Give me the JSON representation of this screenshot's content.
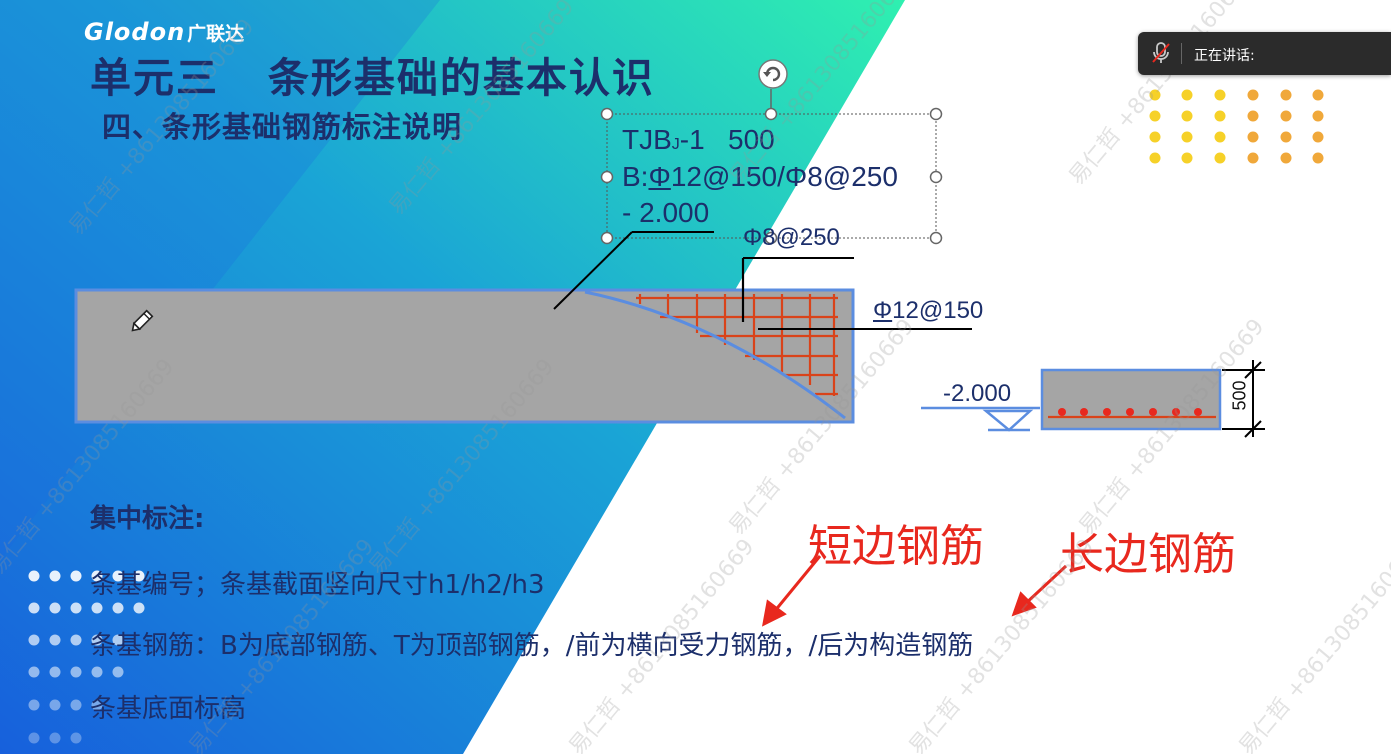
{
  "slide": {
    "logo_latin": "Glodon",
    "logo_cn": "广联达",
    "title": "单元三   条形基础的基本认识",
    "subtitle": "四、条形基础钢筋标注说明",
    "annotation": {
      "line1_main": "TJB",
      "line1_sub": "J",
      "line1_rest": "-1   500",
      "line2_prefix": "B:",
      "line2_phi": "Φ",
      "line2_rest": "12@150/Φ8@250",
      "line3": "- 2.000"
    },
    "label_phi8": "Φ8@250",
    "label_phi12_phi": "Φ",
    "label_phi12_rest": "12@150",
    "elevation_label": "-2.000",
    "dimension_label": "500",
    "section_heading": "集中标注:",
    "body_line1": "条基编号；条基截面竖向尺寸h1/h2/h3",
    "body_line2": "条基钢筋：B为底部钢筋、T为顶部钢筋，/前为横向受力钢筋，/后为构造钢筋",
    "body_line3": "条基底面标高",
    "red_label_short": "短边钢筋",
    "red_label_long": "长边钢筋",
    "watermark_name": "易仁哲",
    "watermark_phone": "+8613085160669"
  },
  "meeting_bar": {
    "speaking_label": "正在讲话:",
    "mic_icon": "mic-muted-icon"
  },
  "colors": {
    "navy_text": "#1c2f6b",
    "red_annotation": "#e8281e",
    "rebar_orange": "#d9431a",
    "blue_gradient_start": "#1a6fe0",
    "teal_gradient_end": "#2ee8b4",
    "footing_gray": "#a5a5a5",
    "footing_border": "#5b8de0",
    "dot_yellow": "#f6d128",
    "dot_orange": "#f0a83a"
  }
}
